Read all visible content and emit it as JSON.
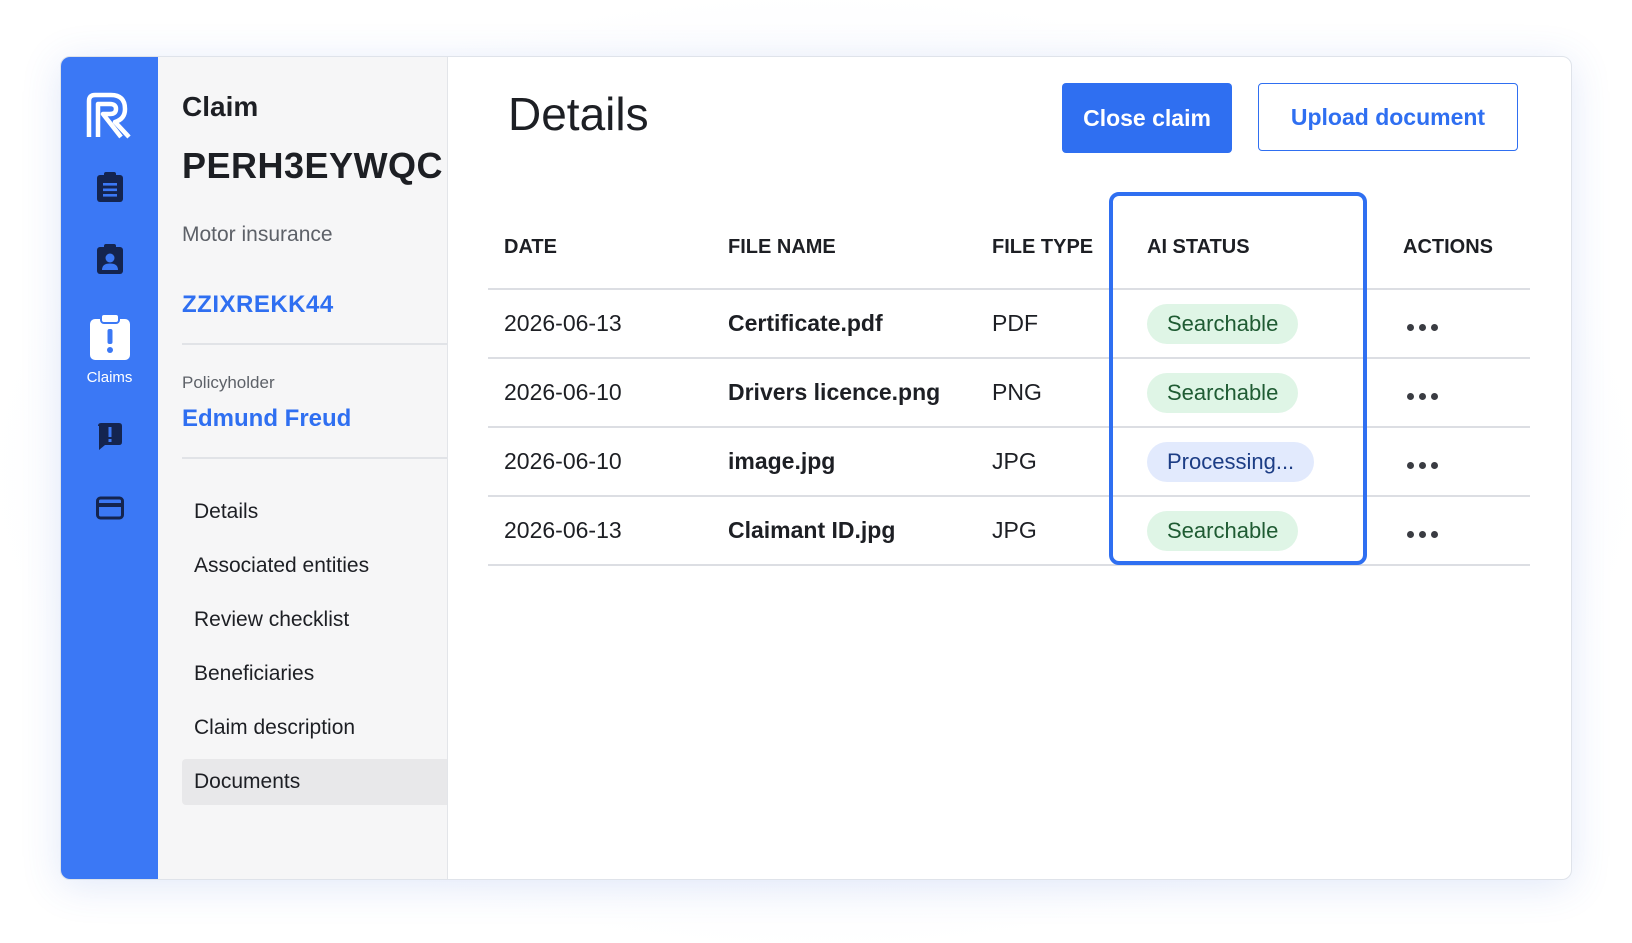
{
  "rail": {
    "items": [
      {
        "name": "clipboard-list",
        "label": ""
      },
      {
        "name": "contact-badge",
        "label": ""
      },
      {
        "name": "claims",
        "label": "Claims"
      },
      {
        "name": "alert",
        "label": ""
      },
      {
        "name": "card",
        "label": ""
      }
    ]
  },
  "side": {
    "claim_label": "Claim",
    "claim_id": "PERH3EYWQC",
    "claim_type": "Motor insurance",
    "reference": "ZZIXREKK44",
    "policyholder_label": "Policyholder",
    "policyholder_name": "Edmund Freud",
    "menu": [
      "Details",
      "Associated entities",
      "Review checklist",
      "Beneficiaries",
      "Claim description",
      "Documents"
    ],
    "active_menu": "Documents"
  },
  "main": {
    "title": "Details",
    "close_button": "Close claim",
    "upload_button": "Upload document",
    "columns": [
      "DATE",
      "FILE NAME",
      "FILE TYPE",
      "AI STATUS",
      "ACTIONS"
    ],
    "rows": [
      {
        "date": "2026-06-13",
        "file": "Certificate.pdf",
        "type": "PDF",
        "status": "Searchable",
        "status_kind": "searchable"
      },
      {
        "date": "2026-06-10",
        "file": "Drivers licence.png",
        "type": "PNG",
        "status": "Searchable",
        "status_kind": "searchable"
      },
      {
        "date": "2026-06-10",
        "file": "image.jpg",
        "type": "JPG",
        "status": "Processing...",
        "status_kind": "processing"
      },
      {
        "date": "2026-06-13",
        "file": "Claimant ID.jpg",
        "type": "JPG",
        "status": "Searchable",
        "status_kind": "searchable"
      }
    ]
  },
  "colors": {
    "rail": "#3b78f5",
    "accent": "#2f6ff1",
    "searchable_bg": "#dff5e6",
    "processing_bg": "#e2eafd"
  }
}
